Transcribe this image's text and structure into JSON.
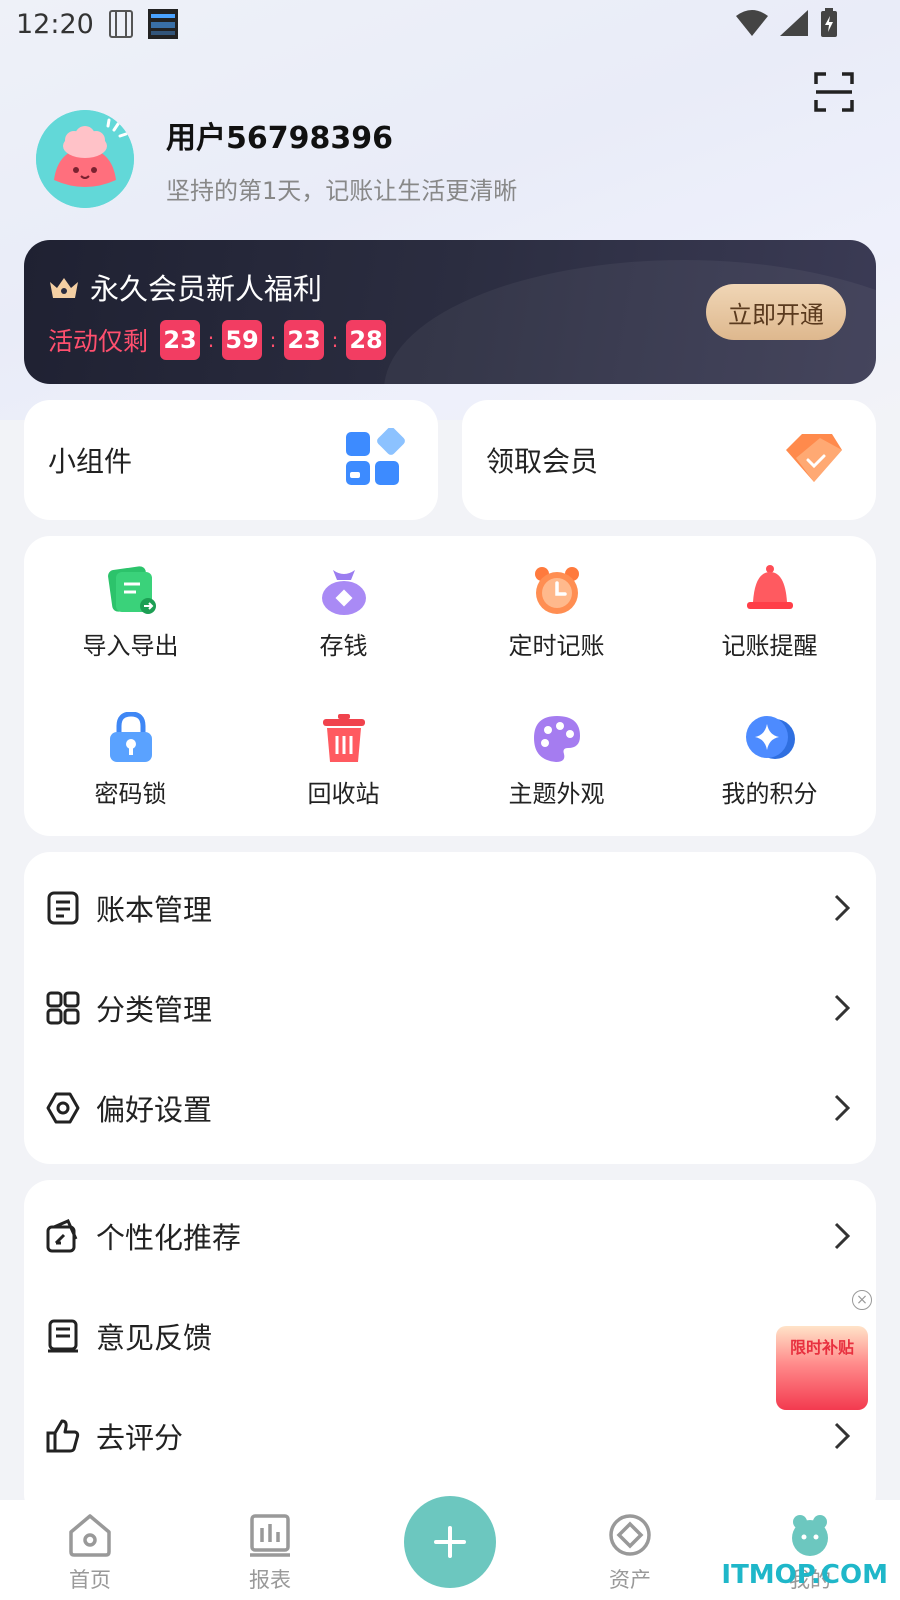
{
  "status_bar": {
    "time": "12:20"
  },
  "profile": {
    "username": "用户56798396",
    "tagline": "坚持的第1天，记账让生活更清晰"
  },
  "vip": {
    "title": "永久会员新人福利",
    "countdown_label": "活动仅剩",
    "countdown": [
      "23",
      "59",
      "23",
      "28"
    ],
    "separator": ":",
    "button": "立即开通"
  },
  "quick_cards": [
    {
      "label": "小组件",
      "icon": "widget-icon"
    },
    {
      "label": "领取会员",
      "icon": "diamond-icon"
    }
  ],
  "tools": [
    {
      "label": "导入导出",
      "icon": "import-export-icon"
    },
    {
      "label": "存钱",
      "icon": "money-bag-icon"
    },
    {
      "label": "定时记账",
      "icon": "alarm-clock-icon"
    },
    {
      "label": "记账提醒",
      "icon": "bell-icon"
    },
    {
      "label": "密码锁",
      "icon": "lock-icon"
    },
    {
      "label": "回收站",
      "icon": "trash-icon"
    },
    {
      "label": "主题外观",
      "icon": "palette-icon"
    },
    {
      "label": "我的积分",
      "icon": "points-icon"
    }
  ],
  "menu_group_1": [
    {
      "label": "账本管理",
      "icon": "ledger-icon"
    },
    {
      "label": "分类管理",
      "icon": "category-grid-icon"
    },
    {
      "label": "偏好设置",
      "icon": "settings-hexagon-icon"
    }
  ],
  "menu_group_2": [
    {
      "label": "个性化推荐",
      "icon": "personalize-icon"
    },
    {
      "label": "意见反馈",
      "icon": "feedback-icon"
    },
    {
      "label": "去评分",
      "icon": "thumbs-up-icon"
    }
  ],
  "promo": {
    "label": "限时补贴"
  },
  "bottom_nav": [
    {
      "label": "首页",
      "icon": "home-icon"
    },
    {
      "label": "报表",
      "icon": "report-icon"
    },
    {
      "label": "资产",
      "icon": "asset-icon"
    },
    {
      "label": "我的",
      "icon": "me-icon"
    }
  ],
  "watermark": "ITMOP.COM",
  "colors": {
    "accent_teal": "#6cc7bf",
    "countdown_red": "#f23d62",
    "vip_button_gold": "#e5c29c"
  }
}
